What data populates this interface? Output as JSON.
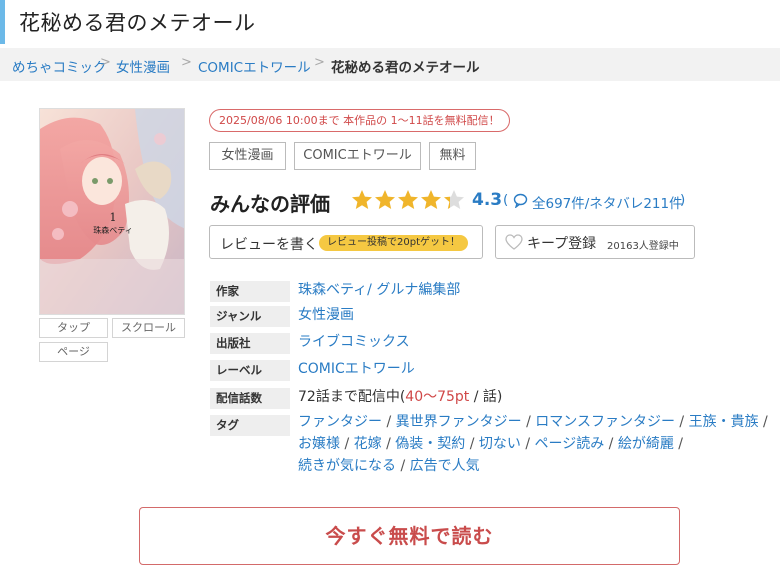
{
  "page": {
    "title": "花秘める君のメテオール"
  },
  "breadcrumb": {
    "items": [
      "めちゃコミック",
      "女性漫画",
      "COMICエトワール"
    ],
    "current": "花秘める君のメテオール",
    "separator": ">"
  },
  "cover": {
    "alt_title": "花秘める君のメテオール",
    "volume": "1",
    "author_on_cover": "珠森ベティ"
  },
  "view_buttons": [
    "タップ",
    "スクロール",
    "ページ"
  ],
  "notice": "2025/08/06 10:00まで 本作品の 1～11話を無料配信！",
  "tags_top": [
    "女性漫画",
    "COMICエトワール",
    "無料"
  ],
  "rating": {
    "label": "みんなの評価",
    "score": "4.3",
    "stars": 4.3,
    "paren_open": "(",
    "count_text": "全697件/ネタバレ211件",
    "paren_close": ")",
    "icon": "speech-bubble-icon"
  },
  "review_button": {
    "label": "レビューを書く",
    "promo": "レビュー投稿で20ptゲット！"
  },
  "keep_button": {
    "label": "キープ登録",
    "count": "20163人登録中",
    "icon": "heart-icon"
  },
  "info": {
    "author_label": "作家",
    "author_value": "珠森ベティ/ グルナ編集部",
    "genre_label": "ジャンル",
    "genre_value": "女性漫画",
    "publisher_label": "出版社",
    "publisher_value": "ライブコミックス",
    "label_label": "レーベル",
    "label_value": "COMICエトワール",
    "episodes_label": "配信話数",
    "episodes_pre": "72話まで配信中(",
    "episodes_price": "40〜75pt",
    "episodes_post": " / 話)",
    "tags_label": "タグ",
    "tags": [
      "ファンタジー",
      "異世界ファンタジー",
      "ロマンスファンタジー",
      "王族・貴族",
      "お嬢様",
      "花嫁",
      "偽装・契約",
      "切ない",
      "ページ読み",
      "絵が綺麗",
      "続きが気になる",
      "広告で人気"
    ]
  },
  "read_button": {
    "label": "今すぐ無料で読む"
  },
  "colors": {
    "accent": "#6cb9e8",
    "link": "#2a7cc4",
    "cta": "#c94c4c",
    "star": "#f0b52b",
    "promo": "#f5c842"
  }
}
